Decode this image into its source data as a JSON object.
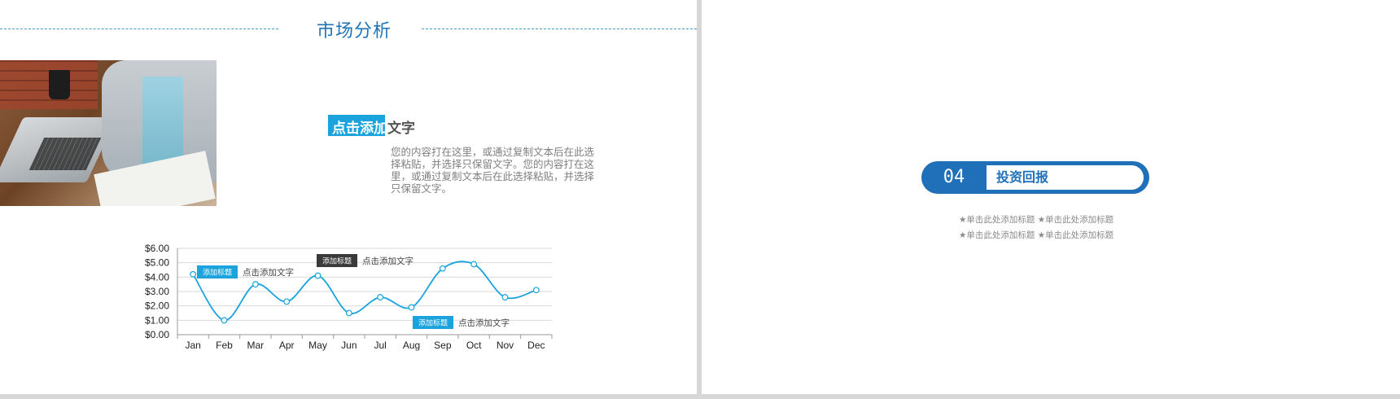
{
  "left_slide": {
    "title": "市场分析",
    "heading_highlight": "点击添加",
    "heading_rest": "文字",
    "body": "您的内容打在这里，或通过复制文本后在此选择粘贴，并选择只保留文字。您的内容打在这里，或通过复制文本后在此选择粘贴，并选择只保留文字。"
  },
  "chart_data": {
    "type": "line",
    "categories": [
      "Jan",
      "Feb",
      "Mar",
      "Apr",
      "May",
      "Jun",
      "Jul",
      "Aug",
      "Sep",
      "Oct",
      "Nov",
      "Dec"
    ],
    "values": [
      4.2,
      1.0,
      3.5,
      2.3,
      4.1,
      1.5,
      2.6,
      1.9,
      4.6,
      4.9,
      2.6,
      3.1
    ],
    "ylim": [
      0,
      6
    ],
    "yticks": [
      "$0.00",
      "$1.00",
      "$2.00",
      "$3.00",
      "$4.00",
      "$5.00",
      "$6.00"
    ],
    "grid": true,
    "color": "#1aa3dd",
    "annotations": [
      {
        "label": "添加标题",
        "text": "点击添加文字",
        "label_color": "#1aa3dd"
      },
      {
        "label": "添加标题",
        "text": "点击添加文字",
        "label_color": "#3a3a3a"
      },
      {
        "label": "添加标题",
        "text": "点击添加文字",
        "label_color": "#1aa3dd"
      }
    ]
  },
  "right_slide": {
    "section_number": "04",
    "section_title": "投资回报",
    "subtitles": [
      "★单击此处添加标题 ★单击此处添加标题",
      "★单击此处添加标题 ★单击此处添加标题"
    ]
  },
  "colors": {
    "accent": "#1aa3dd",
    "brand_blue": "#1f70b8"
  }
}
